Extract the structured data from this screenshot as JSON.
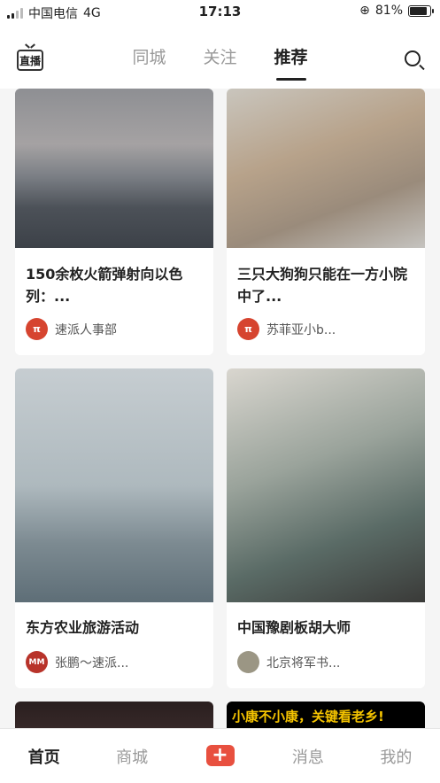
{
  "status_bar": {
    "carrier": "中国电信",
    "network": "4G",
    "time": "17:13",
    "battery": "81%"
  },
  "header": {
    "live_icon_label": "直播",
    "tabs": [
      {
        "label": "同城",
        "active": false
      },
      {
        "label": "关注",
        "active": false
      },
      {
        "label": "推荐",
        "active": true
      }
    ]
  },
  "feed": {
    "cards": [
      {
        "title": "150余枚火箭弹射向以色列：...",
        "author": "速派人事部",
        "avatar_text": "π",
        "avatar_color": "#d6442f"
      },
      {
        "title": "三只大狗狗只能在一方小院中了...",
        "author": "苏菲亚小b...",
        "avatar_text": "π",
        "avatar_color": "#d6442f"
      },
      {
        "title": "东方农业旅游活动",
        "author": "张鹏～速派...",
        "avatar_text": "MM",
        "avatar_color": "#b8332a"
      },
      {
        "title": "中国豫剧板胡大师",
        "author": "北京将军书...",
        "avatar_text": "",
        "avatar_color": "#9b9684"
      },
      {
        "banner_text": ""
      },
      {
        "banner_text": "小康不小康，关键看老乡!"
      }
    ]
  },
  "bottom_nav": {
    "home": "首页",
    "mall": "商城",
    "plus": "+",
    "messages": "消息",
    "mine": "我的"
  }
}
